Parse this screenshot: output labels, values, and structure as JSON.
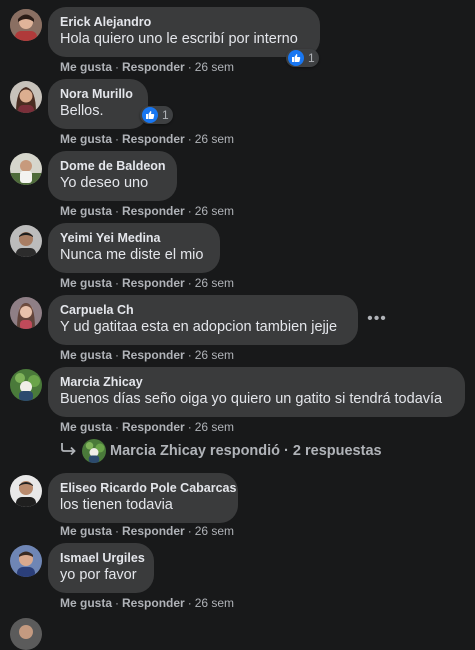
{
  "comments": [
    {
      "author": "Erick Alejandro",
      "text": "Hola quiero uno le escribí por interno",
      "like": "Me gusta",
      "reply": "Responder",
      "time": "26 sem",
      "reactions": "1"
    },
    {
      "author": "Nora Murillo",
      "text": "Bellos.",
      "like": "Me gusta",
      "reply": "Responder",
      "time": "26 sem",
      "reactions": "1"
    },
    {
      "author": "Dome de Baldeon",
      "text": "Yo deseo uno",
      "like": "Me gusta",
      "reply": "Responder",
      "time": "26 sem"
    },
    {
      "author": "Yeimi Yei Medina",
      "text": "Nunca me diste el mio",
      "like": "Me gusta",
      "reply": "Responder",
      "time": "26 sem"
    },
    {
      "author": "Carpuela Ch",
      "text": "Y ud gatitaa esta en adopcion tambien jejje",
      "like": "Me gusta",
      "reply": "Responder",
      "time": "26 sem"
    },
    {
      "author": "Marcia Zhicay",
      "text": "Buenos días seño oiga yo quiero un gatito si tendrá todavía",
      "like": "Me gusta",
      "reply": "Responder",
      "time": "26 sem"
    },
    {
      "author": "Eliseo Ricardo Pole Cabarcas",
      "text": "los tienen todavia",
      "like": "Me gusta",
      "reply": "Responder",
      "time": "26 sem"
    },
    {
      "author": "Ismael Urgiles",
      "text": "yo por favor",
      "like": "Me gusta",
      "reply": "Responder",
      "time": "26 sem"
    }
  ],
  "reply_thread": {
    "text": "Marcia Zhicay respondió · 2 respuestas"
  },
  "icons": {
    "like": "thumbs-up-icon",
    "more": "more-options-icon",
    "reply_arrow": "reply-arrow-icon"
  },
  "colors": {
    "background": "#18191a",
    "bubble": "#3a3b3c",
    "like_blue": "#1877f2",
    "meta_text": "#b0b3b8"
  }
}
